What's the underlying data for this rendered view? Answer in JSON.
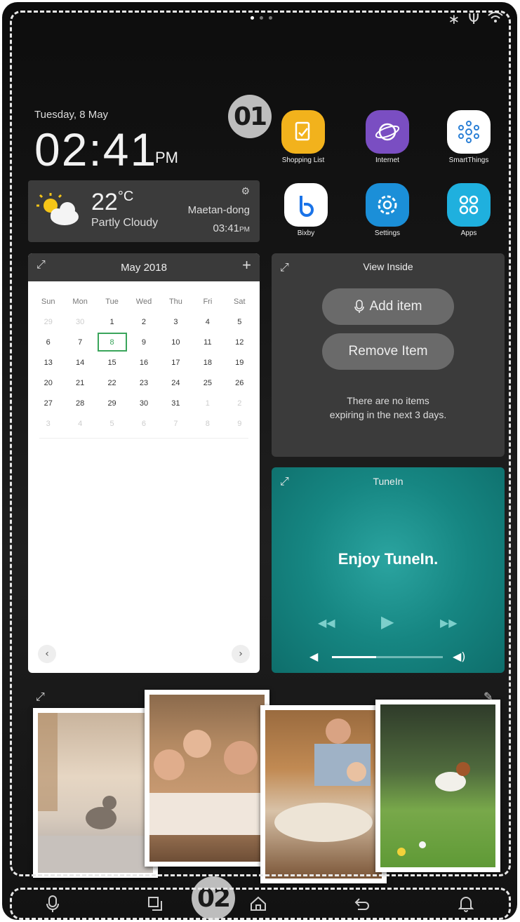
{
  "callouts": {
    "top": "01",
    "bottom": "02"
  },
  "clock": {
    "date": "Tuesday, 8 May",
    "time": "02:41",
    "ampm": "PM"
  },
  "apps": [
    {
      "label": "Shopping List",
      "icon": "shopping-list-icon",
      "color": "#f2b21c"
    },
    {
      "label": "Internet",
      "icon": "internet-icon",
      "color": "#7a4ec2"
    },
    {
      "label": "SmartThings",
      "icon": "smartthings-icon",
      "color": "#ffffff"
    },
    {
      "label": "Bixby",
      "icon": "bixby-icon",
      "color": "#ffffff"
    },
    {
      "label": "Settings",
      "icon": "settings-icon",
      "color": "#1b8fd8"
    },
    {
      "label": "Apps",
      "icon": "apps-icon",
      "color": "#1fb0de"
    }
  ],
  "weather": {
    "temp": "22",
    "unit": "°C",
    "condition": "Partly Cloudy",
    "location": "Maetan-dong",
    "updated": "03:41",
    "updated_ampm": "PM"
  },
  "calendar": {
    "title": "May 2018",
    "days": [
      "Sun",
      "Mon",
      "Tue",
      "Wed",
      "Thu",
      "Fri",
      "Sat"
    ],
    "weeks": [
      [
        "29",
        "30",
        "1",
        "2",
        "3",
        "4",
        "5"
      ],
      [
        "6",
        "7",
        "8",
        "9",
        "10",
        "11",
        "12"
      ],
      [
        "13",
        "14",
        "15",
        "16",
        "17",
        "18",
        "19"
      ],
      [
        "20",
        "21",
        "22",
        "23",
        "24",
        "25",
        "26"
      ],
      [
        "27",
        "28",
        "29",
        "30",
        "31",
        "1",
        "2"
      ],
      [
        "3",
        "4",
        "5",
        "6",
        "7",
        "8",
        "9"
      ]
    ],
    "today": "8"
  },
  "view_inside": {
    "title": "View Inside",
    "add_label": "Add item",
    "remove_label": "Remove Item",
    "message_line1": "There are no items",
    "message_line2": "expiring in the next 3 days."
  },
  "tunein": {
    "title": "TuneIn",
    "message": "Enjoy TuneIn.",
    "volume": 0.4
  },
  "accent": {
    "today": "#3aa55b",
    "tunein": "#168682"
  }
}
